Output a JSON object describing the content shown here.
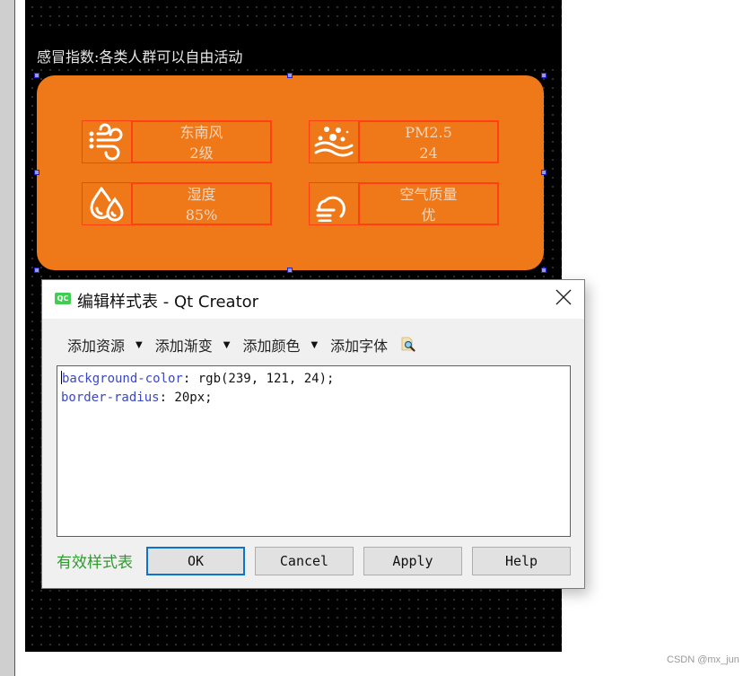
{
  "canvas": {
    "status_label": "感冒指数:各类人群可以自由活动",
    "panel_color": "#ef7918",
    "cells": [
      {
        "icon": "wind-icon",
        "line1": "东南风",
        "line2": "2级"
      },
      {
        "icon": "pm25-icon",
        "line1": "PM2.5",
        "line2": "24"
      },
      {
        "icon": "humidity-icon",
        "line1": "湿度",
        "line2": "85%"
      },
      {
        "icon": "cloud-fog-icon",
        "line1": "空气质量",
        "line2": "优"
      }
    ]
  },
  "dialog": {
    "app_badge": "QC",
    "title": "编辑样式表 - Qt Creator",
    "toolbar": {
      "add_resource": "添加资源",
      "add_gradient": "添加渐变",
      "add_color": "添加颜色",
      "add_font": "添加字体"
    },
    "editor": {
      "line1_prop": "background-color",
      "line1_val": ": rgb(239, 121, 24);",
      "line2_prop": "border-radius",
      "line2_val": ": 20px;"
    },
    "status": "有效样式表",
    "buttons": {
      "ok": "OK",
      "cancel": "Cancel",
      "apply": "Apply",
      "help": "Help"
    }
  },
  "watermark": "CSDN @mx_jun"
}
